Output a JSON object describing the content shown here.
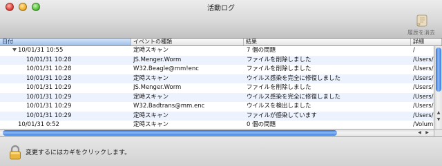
{
  "window": {
    "title": "活動ログ"
  },
  "toolbar": {
    "clear_history_label": "履歴を消去"
  },
  "table": {
    "columns": [
      "日付",
      "イベントの種類",
      "結果",
      "詳細"
    ],
    "rows": [
      {
        "date": "10/01/31 10:55",
        "event": "定時スキャン",
        "result": "7 個の問題",
        "detail": "/",
        "expanded": true,
        "level": 0
      },
      {
        "date": "10/01/31 10:28",
        "event": "JS.Menger.Worm",
        "result": "ファイルを削除しました",
        "detail": "/Users/",
        "level": 1
      },
      {
        "date": "10/01/31 10:28",
        "event": "W32.Beagle@mm!enc",
        "result": "ファイルを削除しました",
        "detail": "/Users/",
        "level": 1
      },
      {
        "date": "10/01/31 10:28",
        "event": "定時スキャン",
        "result": "ウイルス感染を完全に修復しました",
        "detail": "/Users/",
        "level": 1
      },
      {
        "date": "10/01/31 10:29",
        "event": "JS.Menger.Worm",
        "result": "ファイルを削除しました",
        "detail": "/Users/",
        "level": 1
      },
      {
        "date": "10/01/31 10:29",
        "event": "定時スキャン",
        "result": "ウイルス感染を完全に修復しました",
        "detail": "/Users/",
        "level": 1
      },
      {
        "date": "10/01/31 10:29",
        "event": "W32.Badtrans@mm.enc",
        "result": "ウイルスを検出しました",
        "detail": "/Users/",
        "level": 1
      },
      {
        "date": "10/01/31 10:29",
        "event": "定時スキャン",
        "result": "ファイルが感染しています",
        "detail": "/Users/",
        "level": 1
      },
      {
        "date": "10/01/31 0:52",
        "event": "定時スキャン",
        "result": "0 個の問題",
        "detail": "/Volum",
        "level": 0
      }
    ]
  },
  "footer": {
    "lock_message": "変更するにはカギをクリックします。"
  },
  "icons": {
    "lock": "padlock-icon",
    "clear": "scroll-icon"
  }
}
